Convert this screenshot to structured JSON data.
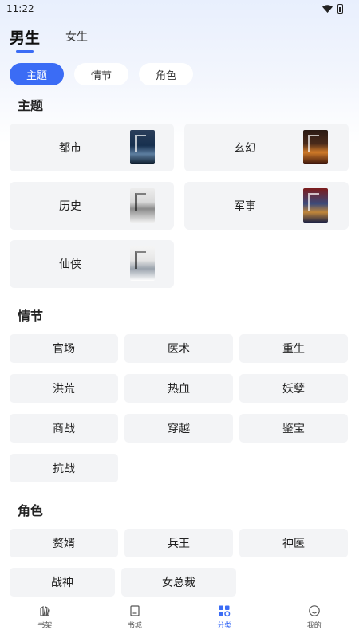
{
  "status_bar": {
    "time": "11:22"
  },
  "gender_tabs": [
    {
      "label": "男生",
      "active": true
    },
    {
      "label": "女生",
      "active": false
    }
  ],
  "filter_chips": [
    {
      "label": "主题",
      "active": true
    },
    {
      "label": "情节",
      "active": false
    },
    {
      "label": "角色",
      "active": false
    }
  ],
  "themes": {
    "title": "主题",
    "items": [
      {
        "label": "都市",
        "cover_icon": "book-cover-ink-landscape"
      },
      {
        "label": "玄幻",
        "cover_icon": "book-cover-fantasy"
      },
      {
        "label": "历史",
        "cover_icon": "book-cover-history"
      },
      {
        "label": "军事",
        "cover_icon": "book-cover-military"
      },
      {
        "label": "仙侠",
        "cover_icon": "book-cover-xianxia"
      }
    ]
  },
  "plots": {
    "title": "情节",
    "items": [
      "官场",
      "医术",
      "重生",
      "洪荒",
      "热血",
      "妖孽",
      "商战",
      "穿越",
      "鉴宝",
      "抗战"
    ]
  },
  "roles": {
    "title": "角色",
    "items_row1": [
      "赘婿",
      "兵王",
      "神医"
    ],
    "items_row2": [
      "战神",
      "女总裁"
    ]
  },
  "tab_bar": [
    {
      "label": "书架",
      "icon": "bookshelf-icon",
      "active": false
    },
    {
      "label": "书城",
      "icon": "bookstore-icon",
      "active": false
    },
    {
      "label": "分类",
      "icon": "category-icon",
      "active": true
    },
    {
      "label": "我的",
      "icon": "profile-icon",
      "active": false
    }
  ],
  "colors": {
    "accent": "#3b6cf5",
    "card_bg": "#f3f4f6"
  }
}
